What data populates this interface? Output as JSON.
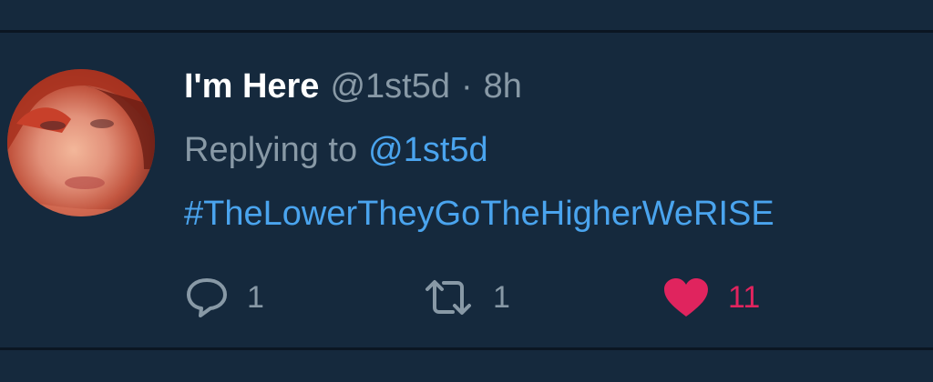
{
  "tweet": {
    "display_name": "I'm Here",
    "handle": "@1st5d",
    "separator": "·",
    "time": "8h",
    "replying_prefix": "Replying to",
    "replying_handle": "@1st5d",
    "hashtag": "#TheLowerTheyGoTheHigherWeRISE"
  },
  "actions": {
    "reply": {
      "icon": "reply-icon",
      "count": "1"
    },
    "retweet": {
      "icon": "retweet-icon",
      "count": "1"
    },
    "like": {
      "icon": "heart-icon",
      "count": "11"
    }
  },
  "colors": {
    "background": "#15293d",
    "muted": "#8899a6",
    "link": "#4aa4ee",
    "like": "#e0245e"
  }
}
